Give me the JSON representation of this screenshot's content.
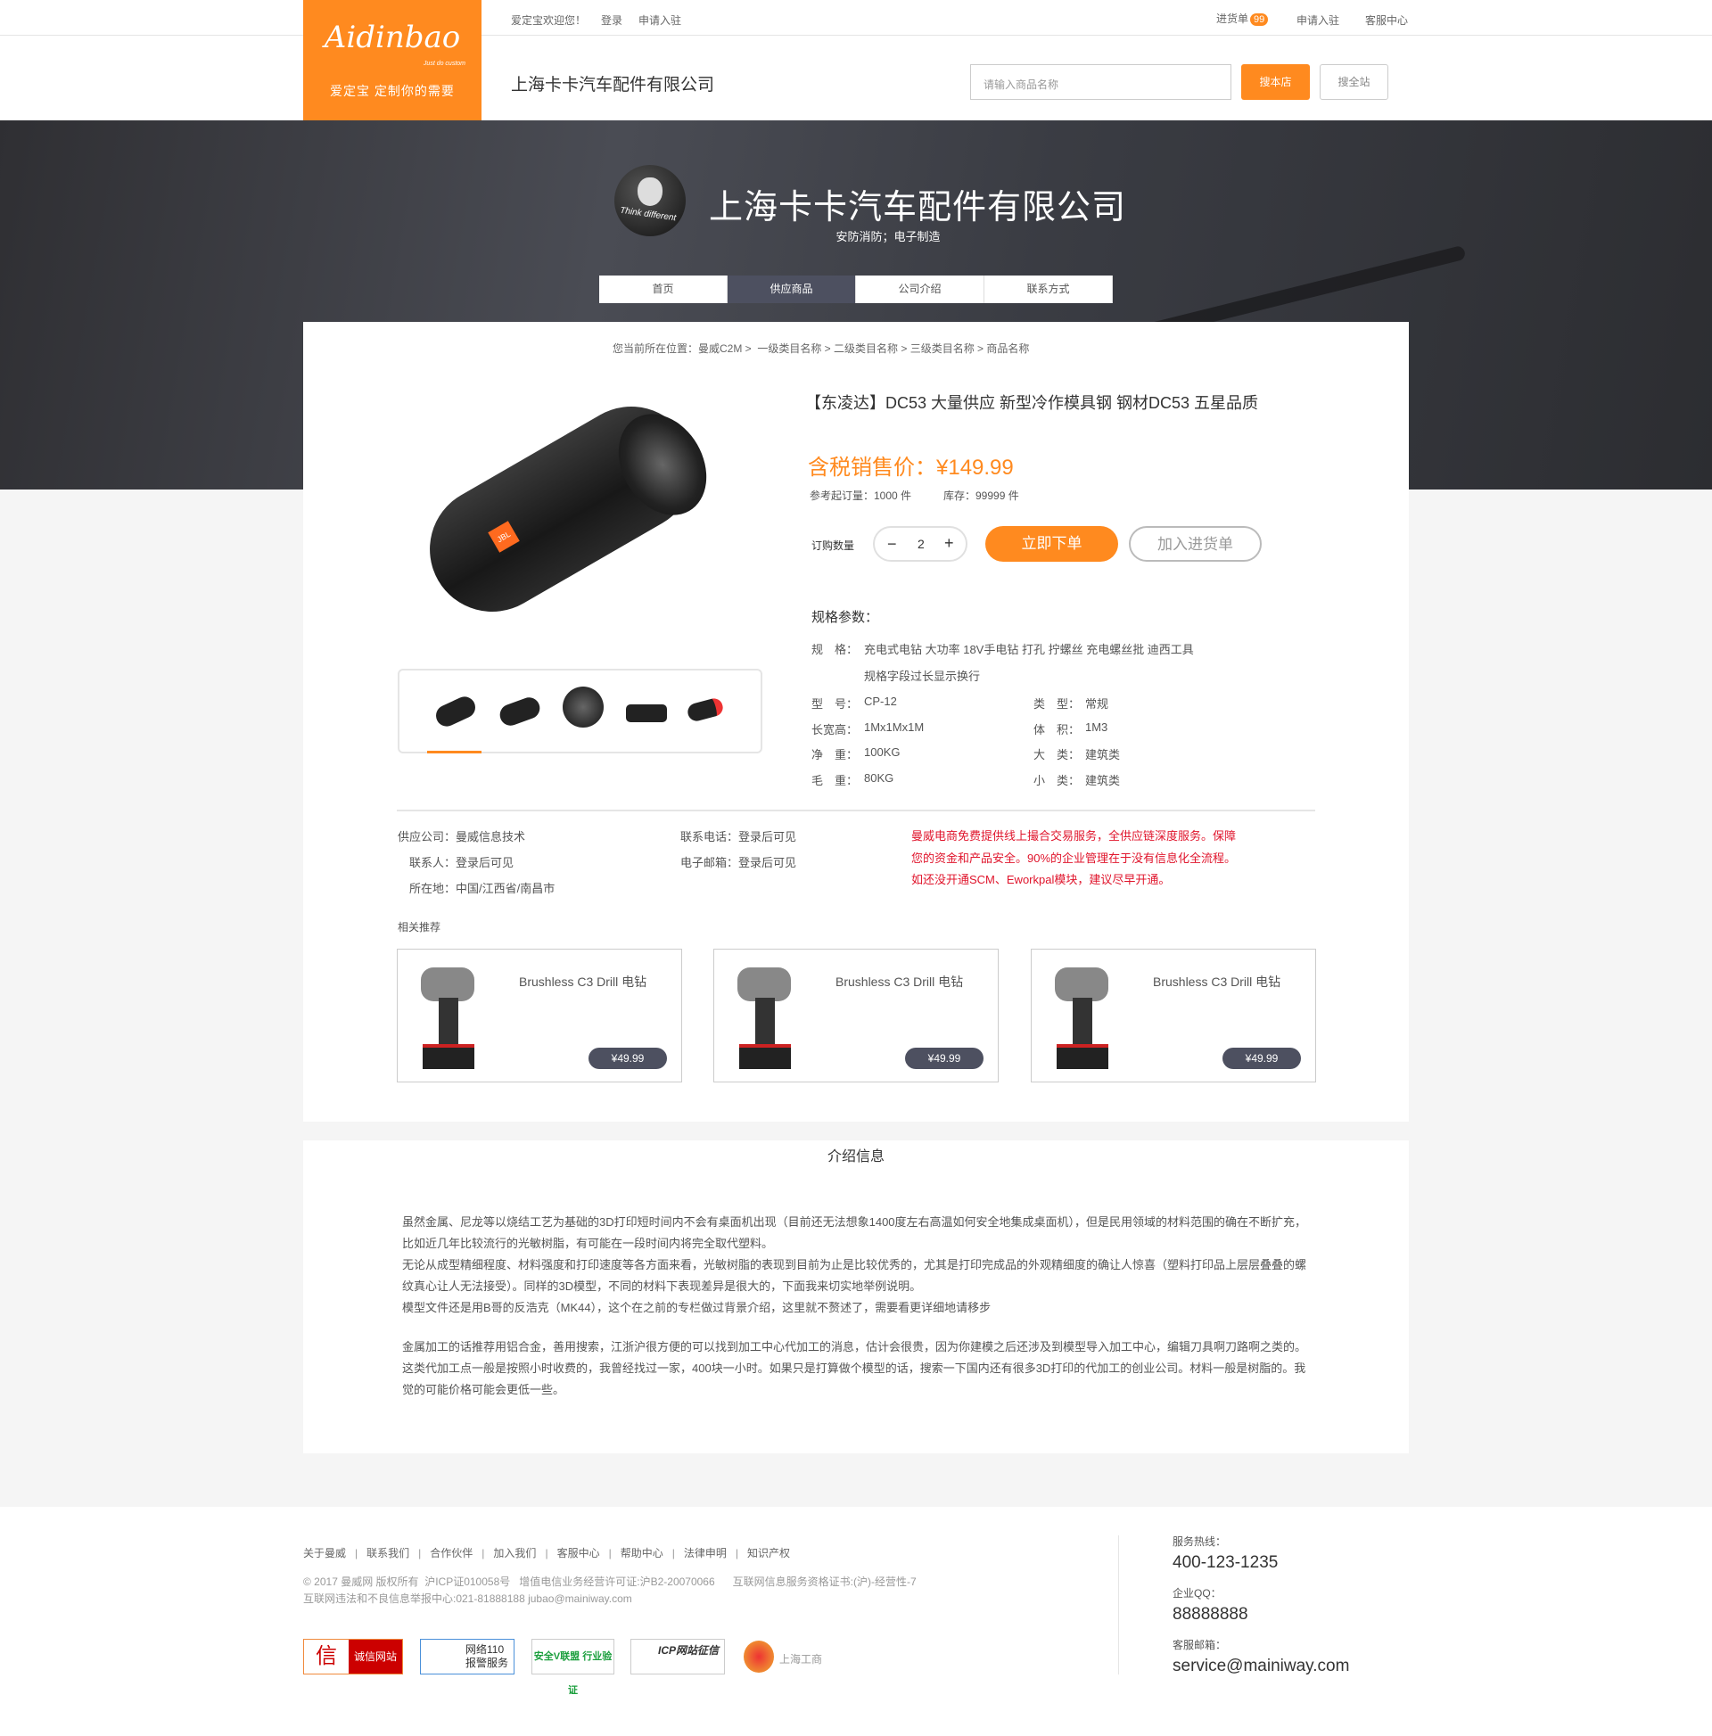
{
  "topbar": {
    "welcome": "爱定宝欢迎您！",
    "login": "登录",
    "apply": "申请入驻",
    "cart": "进货单",
    "cart_count": "99",
    "apply_right": "申请入驻",
    "service": "客服中心"
  },
  "logo": {
    "script": "Aidinbao",
    "tagline": "Just do custom",
    "slogan": "爱定宝  定制你的需要"
  },
  "header": {
    "company": "上海卡卡汽车配件有限公司",
    "search_placeholder": "请输入商品名称",
    "search_store": "搜本店",
    "search_all": "搜全站"
  },
  "banner": {
    "avatar_text": "Think different",
    "title": "上海卡卡汽车配件有限公司",
    "subtitle": "安防消防；电子制造",
    "nav": [
      {
        "label": "首页"
      },
      {
        "label": "供应商品"
      },
      {
        "label": "公司介绍"
      },
      {
        "label": "联系方式"
      }
    ]
  },
  "breadcrumb": "您当前所在位置：曼威C2M >  一级类目名称 > 二级类目名称 > 三级类目名称 > 商品名称",
  "product": {
    "title": "【东凌达】DC53 大量供应 新型冷作模具钢 钢材DC53 五星品质",
    "price_label": "含税销售价：",
    "price": "¥149.99",
    "moq": "参考起订量：1000 件",
    "stock": "库存：99999 件",
    "qty_label": "订购数量",
    "qty": "2",
    "buy": "立即下单",
    "add_cart": "加入进货单",
    "brand": "JBL"
  },
  "specs": {
    "title": "规格参数：",
    "spec_label": "规　格：",
    "spec_value": "充电式电钻 大功率 18V手电钻 打孔 拧螺丝 充电螺丝批 迪西工具",
    "spec_value2": "规格字段过长显示换行",
    "rows": [
      {
        "l1": "型　号：",
        "v1": "CP-12",
        "l2": "类　型：",
        "v2": "常规"
      },
      {
        "l1": "长宽高：",
        "v1": "1Mx1Mx1M",
        "l2": "体　积：",
        "v2": "1M3"
      },
      {
        "l1": "净　重：",
        "v1": "100KG",
        "l2": "大　类：",
        "v2": "建筑类"
      },
      {
        "l1": "毛　重：",
        "v1": "80KG",
        "l2": "小　类：",
        "v2": "建筑类"
      }
    ]
  },
  "supplier": {
    "company": "供应公司：曼威信息技术",
    "contact": "联系人：登录后可见",
    "location": "所在地：中国/江西省/南昌市",
    "phone": "联系电话：登录后可见",
    "email": "电子邮箱：登录后可见",
    "notice": [
      "曼威电商免费提供线上撮合交易服务，全供应链深度服务。保障",
      "您的资金和产品安全。90%的企业管理在于没有信息化全流程。",
      "如还没开通SCM、Eworkpal模块，建议尽早开通。"
    ],
    "notice_color": "#e0152c"
  },
  "related": {
    "title": "相关推荐",
    "items": [
      {
        "name": "Brushless C3 Drill 电钻",
        "price": "¥49.99"
      },
      {
        "name": "Brushless C3 Drill 电钻",
        "price": "¥49.99"
      },
      {
        "name": "Brushless C3 Drill 电钻",
        "price": "¥49.99"
      }
    ]
  },
  "intro": {
    "title": "介绍信息",
    "paragraphs": [
      "虽然金属、尼龙等以烧结工艺为基础的3D打印短时间内不会有桌面机出现（目前还无法想象1400度左右高温如何安全地集成桌面机），但是民用领域的材料范围的确在不断扩充，比如近几年比较流行的光敏树脂，有可能在一段时间内将完全取代塑料。",
      "无论从成型精细程度、材料强度和打印速度等各方面来看，光敏树脂的表现到目前为止是比较优秀的，尤其是打印完成品的外观精细度的确让人惊喜（塑料打印品上层层叠叠的螺纹真心让人无法接受）。同样的3D模型，不同的材料下表现差异是很大的，下面我来切实地举例说明。",
      "模型文件还是用B哥的反浩克（MK44），这个在之前的专栏做过背景介绍，这里就不赘述了，需要看更详细地请移步",
      "金属加工的话推荐用铝合金，善用搜索，江浙沪很方便的可以找到加工中心代加工的消息，估计会很贵，因为你建模之后还涉及到模型导入加工中心，编辑刀具啊刀路啊之类的。这类代加工点一般是按照小时收费的，我曾经找过一家，400块一小时。如果只是打算做个模型的话，搜索一下国内还有很多3D打印的代加工的创业公司。材料一般是树脂的。我觉的可能价格可能会更低一些。"
    ]
  },
  "footer": {
    "links": [
      "关于曼威",
      "联系我们",
      "合作伙伴",
      "加入我们",
      "客服中心",
      "帮助中心",
      "法律申明",
      "知识产权"
    ],
    "copyright": "© 2017 曼威网 版权所有  沪ICP证010058号   增值电信业务经营许可证:沪B2-20070066      互联网信息服务资格证书:(沪)-经营性-7",
    "report": "互联网违法和不良信息举报中心:021-81888188 jubao@mainiway.com",
    "certs": [
      "诚信网站",
      "网络110 报警服务",
      "安全V联盟 行业验证",
      "ICP网站征信",
      "上海工商"
    ],
    "hotline_label": "服务热线：",
    "hotline": "400-123-1235",
    "qq_label": "企业QQ：",
    "qq": "88888888",
    "email_label": "客服邮箱：",
    "email": "service@mainiway.com"
  },
  "colors": {
    "accent": "#ff8a1f",
    "nav_active": "#4d5060"
  }
}
